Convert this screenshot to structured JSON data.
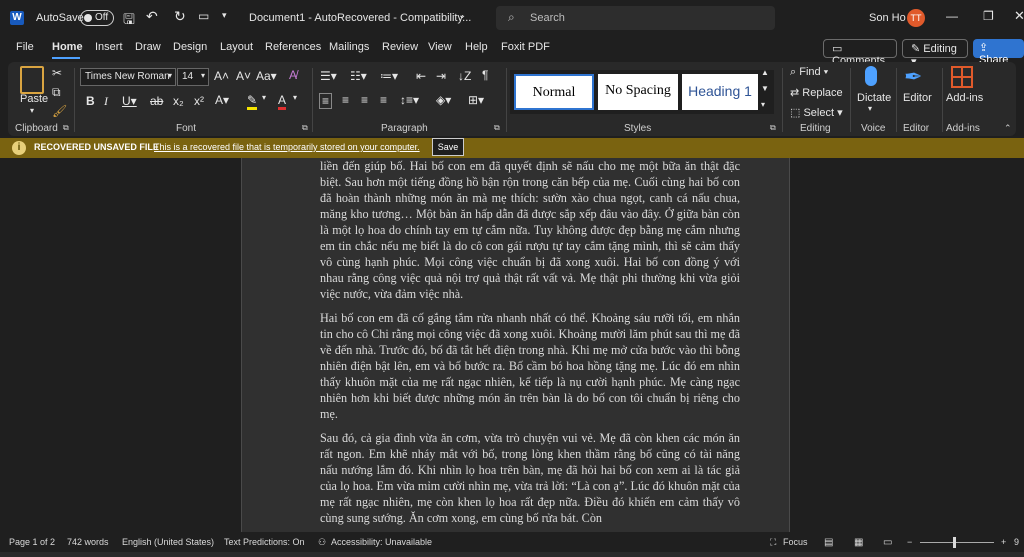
{
  "titlebar": {
    "autosave_label": "AutoSave",
    "autosave_state": "Off",
    "doc_title": "Document1 - AutoRecovered - Compatibility...",
    "search_placeholder": "Search",
    "user_name": "Son Ho",
    "user_initials": "TT"
  },
  "menu": {
    "tabs": [
      "File",
      "Home",
      "Insert",
      "Draw",
      "Design",
      "Layout",
      "References",
      "Mailings",
      "Review",
      "View",
      "Help",
      "Foxit PDF"
    ],
    "active": "Home",
    "comments": "Comments",
    "editing": "Editing",
    "share": "Share"
  },
  "ribbon": {
    "clipboard": {
      "label": "Clipboard",
      "paste": "Paste"
    },
    "font": {
      "label": "Font",
      "name": "Times New Roman",
      "size": "14"
    },
    "paragraph": {
      "label": "Paragraph"
    },
    "styles": {
      "label": "Styles",
      "items": [
        "Normal",
        "No Spacing",
        "Heading 1"
      ]
    },
    "editing": {
      "label": "Editing",
      "find": "Find",
      "replace": "Replace",
      "select": "Select"
    },
    "voice": {
      "label": "Voice",
      "dictate": "Dictate"
    },
    "editor": {
      "label": "Editor",
      "btn": "Editor"
    },
    "addins": {
      "label": "Add-ins",
      "btn": "Add-ins"
    }
  },
  "infobar": {
    "title": "RECOVERED UNSAVED FILE",
    "message": "This is a recovered file that is temporarily stored on your computer.",
    "save": "Save"
  },
  "document": {
    "paragraphs": [
      "liền đến giúp bố. Hai bố con em đã quyết định sẽ nấu cho mẹ một bữa ăn thật đặc biệt. Sau hơn một tiếng đồng hồ bận rộn trong căn bếp của mẹ. Cuối cùng hai bố con đã hoàn thành những món ăn mà mẹ thích: sườn xào chua ngọt, canh cá nấu chua, măng kho tương… Một bàn ăn hấp dẫn đã được sắp xếp đâu vào đây. Ở giữa bàn còn là một lọ hoa do chính tay em tự cắm nữa. Tuy không được đẹp bằng mẹ cắm nhưng em tin chắc nếu mẹ biết là do cô con gái rượu tự tay cắm tặng mình, thì sẽ cảm thấy vô cùng hạnh phúc. Mọi công việc chuẩn bị đã xong xuôi. Hai bố con đồng ý với nhau rằng công việc quả nội trợ quả thật rất vất vả. Mẹ thật phi thường khi vừa giỏi việc nước, vừa đảm việc nhà.",
      "Hai bố con em đã cố gắng tắm rửa nhanh nhất có thể. Khoảng sáu rưỡi tối, em nhắn tin cho cô Chi rằng mọi công việc đã xong xuôi. Khoảng mười lăm phút sau thì mẹ đã về đến nhà. Trước đó, bố đã tắt hết điện trong nhà. Khi mẹ mở cửa bước vào thì bỗng nhiên điện bật lên, em và bố bước ra. Bố cầm bó hoa hồng tặng mẹ. Lúc đó em nhìn thấy khuôn mặt của mẹ rất ngạc nhiên, kế tiếp là nụ cười hạnh phúc. Mẹ càng ngạc nhiên hơn khi biết được những món ăn trên bàn là do bố con tôi chuẩn bị riêng cho mẹ.",
      "Sau đó, cả gia đình vừa ăn cơm, vừa trò chuyện vui vẻ. Mẹ đã còn khen các món ăn rất ngon. Em khẽ nháy mắt với bố, trong lòng khen thầm rằng bố cũng có tài năng nấu nướng lắm đó. Khi nhìn lọ hoa trên bàn, mẹ đã hỏi hai bố con xem ai là tác giả của lọ hoa. Em vừa mỉm cười nhìn mẹ, vừa trả lời: “Là con ạ”. Lúc đó khuôn mặt của mẹ rất ngạc nhiên, mẹ còn khen lọ hoa rất đẹp nữa. Điều đó khiến em cảm thấy vô cùng sung sướng. Ăn cơm xong, em cùng bố rửa bát. Còn"
    ]
  },
  "status": {
    "page": "Page 1 of 2",
    "words": "742 words",
    "language": "English (United States)",
    "predictions": "Text Predictions: On",
    "accessibility": "Accessibility: Unavailable",
    "focus": "Focus",
    "zoom": "9"
  }
}
